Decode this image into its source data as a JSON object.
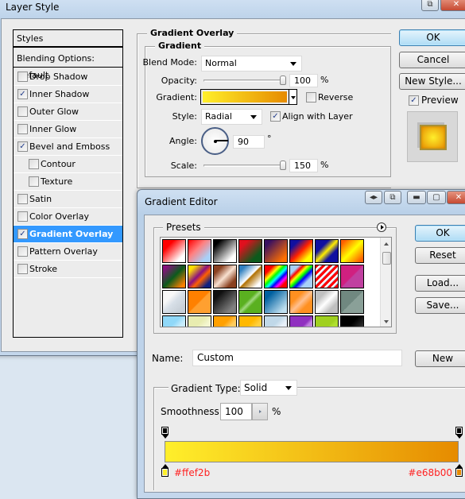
{
  "layer_style": {
    "title": "Layer Style",
    "styles_header": "Styles",
    "blending_options": "Blending Options: Default",
    "style_items": [
      {
        "label": "Drop Shadow",
        "checked": false,
        "indent": false,
        "selected": false
      },
      {
        "label": "Inner Shadow",
        "checked": true,
        "indent": false,
        "selected": false
      },
      {
        "label": "Outer Glow",
        "checked": false,
        "indent": false,
        "selected": false
      },
      {
        "label": "Inner Glow",
        "checked": false,
        "indent": false,
        "selected": false
      },
      {
        "label": "Bevel and Emboss",
        "checked": true,
        "indent": false,
        "selected": false
      },
      {
        "label": "Contour",
        "checked": false,
        "indent": true,
        "selected": false
      },
      {
        "label": "Texture",
        "checked": false,
        "indent": true,
        "selected": false
      },
      {
        "label": "Satin",
        "checked": false,
        "indent": false,
        "selected": false
      },
      {
        "label": "Color Overlay",
        "checked": false,
        "indent": false,
        "selected": false
      },
      {
        "label": "Gradient Overlay",
        "checked": true,
        "indent": false,
        "selected": true
      },
      {
        "label": "Pattern Overlay",
        "checked": false,
        "indent": false,
        "selected": false
      },
      {
        "label": "Stroke",
        "checked": false,
        "indent": false,
        "selected": false
      }
    ],
    "panel_title": "Gradient Overlay",
    "group_title": "Gradient",
    "blend_mode_label": "Blend Mode:",
    "blend_mode_value": "Normal",
    "opacity_label": "Opacity:",
    "opacity_value": "100",
    "opacity_percent": 100,
    "percent_sign": "%",
    "gradient_label": "Gradient:",
    "reverse_label": "Reverse",
    "reverse_checked": false,
    "style_label": "Style:",
    "style_value": "Radial",
    "align_label": "Align with Layer",
    "align_checked": true,
    "angle_label": "Angle:",
    "angle_value": "90",
    "angle_degrees": 90,
    "degree_sign": "°",
    "scale_label": "Scale:",
    "scale_value": "150",
    "scale_fraction": 1.0,
    "buttons": {
      "ok": "OK",
      "cancel": "Cancel",
      "new_style": "New Style..."
    },
    "preview_label": "Preview",
    "preview_checked": true
  },
  "gradient_editor": {
    "title": "Gradient Editor",
    "presets_label": "Presets",
    "buttons": {
      "ok": "OK",
      "reset": "Reset",
      "load": "Load...",
      "save": "Save...",
      "new": "New"
    },
    "name_label": "Name:",
    "name_value": "Custom",
    "gradient_type_label": "Gradient Type:",
    "gradient_type_value": "Solid",
    "smoothness_label": "Smoothness:",
    "smoothness_value": "100",
    "percent_sign": "%",
    "color_stops": [
      {
        "position": 0,
        "color": "#ffef2b",
        "label": "#ffef2b"
      },
      {
        "position": 100,
        "color": "#e68b00",
        "label": "#e68b00"
      }
    ],
    "opacity_stops": [
      {
        "position": 0,
        "opacity": 100
      },
      {
        "position": 100,
        "opacity": 100
      }
    ],
    "presets": [
      "linear-gradient(135deg,#ff0000 0%,#ff0000 25%,#ffffff 80%)",
      "linear-gradient(135deg,#ff0000 0%,#ff8080 40%,#a8d0f8 80%)",
      "linear-gradient(135deg,#000000 15%,#ffffff 80%)",
      "linear-gradient(135deg,#e0101e 20%,#0c5a1c 75%)",
      "linear-gradient(135deg,#3a1060 15%,#ff7000 85%)",
      "linear-gradient(135deg,#1010a0 20%,#ff2000 50%,#ffff00 80%)",
      "linear-gradient(135deg,#1010a0 30%,#ffee00 50%,#1010a0 70%)",
      "linear-gradient(135deg,#ff6000 10%,#ffff00 50%,#ff6000 90%)",
      "linear-gradient(135deg,#8a1080 10%,#0c5a1c 50%,#ff8000 90%)",
      "linear-gradient(135deg,#ffe000 15%,#8a1080 45%,#ff6000 60%,#102080 85%)",
      "linear-gradient(135deg,#8a4020 20%,#f8e0d0 50%,#8a4020 80%)",
      "linear-gradient(135deg,#3080c0 15%,#ffffff 48%,#b07000 52%,#ffffff 85%)",
      "linear-gradient(135deg,#ff0000 20%,#ffff00 35%,#00ff00 45%,#00ffff 55%,#0000ff 65%,#ff00ff 75%,#ff0000 85%)",
      "linear-gradient(135deg,#a8d0f8 20%,#ff0000 30%,#ffff00 40%,#00ff00 50%,#0000ff 60%,#a8d0f8 75%)",
      "repeating-linear-gradient(135deg,#ff0000 0,#ff0000 3px,#ffffff 3px,#ffffff 5px,#a8d0f8 5px,#a8d0f8 6px)",
      "linear-gradient(135deg,#d02080 48%,#c040a0 52%)",
      "linear-gradient(135deg,#f8f8f8 30%,#d8e0e8 50%,#c8d0d8 80%)",
      "linear-gradient(135deg,#ff8000 48%,#ffa030 52%)",
      "linear-gradient(135deg,#101010 20%,#808080 80%)",
      "linear-gradient(135deg,#5ab020 40%,#a0d880 50%,#5ab020 60%)",
      "linear-gradient(135deg,#0060a0 20%,#c0e0f0 85%)",
      "linear-gradient(135deg,#ff9020 30%,#ffc090 50%,#ff9020 70%)",
      "linear-gradient(135deg,#c0c0c0 25%,#ffffff 50%,#c0c0c0 75%)",
      "linear-gradient(135deg,#708880 50%,#8aa098 50%)",
      "linear-gradient(135deg,#90d8f8 40%,#c8ecfc 60%)",
      "linear-gradient(135deg,#e8ecb0 40%,#f4f6d0 60%)",
      "linear-gradient(135deg,#ffa000 40%,#ffcc60 60%)",
      "linear-gradient(135deg,#ffb800 40%,#ffd040 60%)",
      "linear-gradient(135deg,#c0d8e8 40%,#e8f0f8 60%)",
      "linear-gradient(135deg,#9030c0 50%,#c080e0 60%)",
      "linear-gradient(135deg,#a0d020 50%,#b0e030 60%)",
      "linear-gradient(135deg,#000000 40%,#404040 80%)"
    ]
  }
}
